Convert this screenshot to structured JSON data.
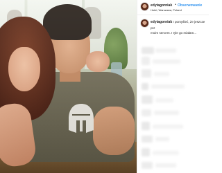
{
  "post": {
    "username": "edytagorniak",
    "follow_label": "Obserwowanie",
    "location": "Hotel, Warszawa, Poland",
    "caption_lines": [
      " I pomyśleć, że jeszcze prz",
      "moim sercem. I tyle go miałam..."
    ]
  },
  "colors": {
    "follow_blue": "#3897f0",
    "text_dark": "#262626",
    "divider": "#efefef"
  },
  "icons": {
    "avatar": "profile-avatar",
    "shirt_print": "spartan-helmet-icon"
  }
}
